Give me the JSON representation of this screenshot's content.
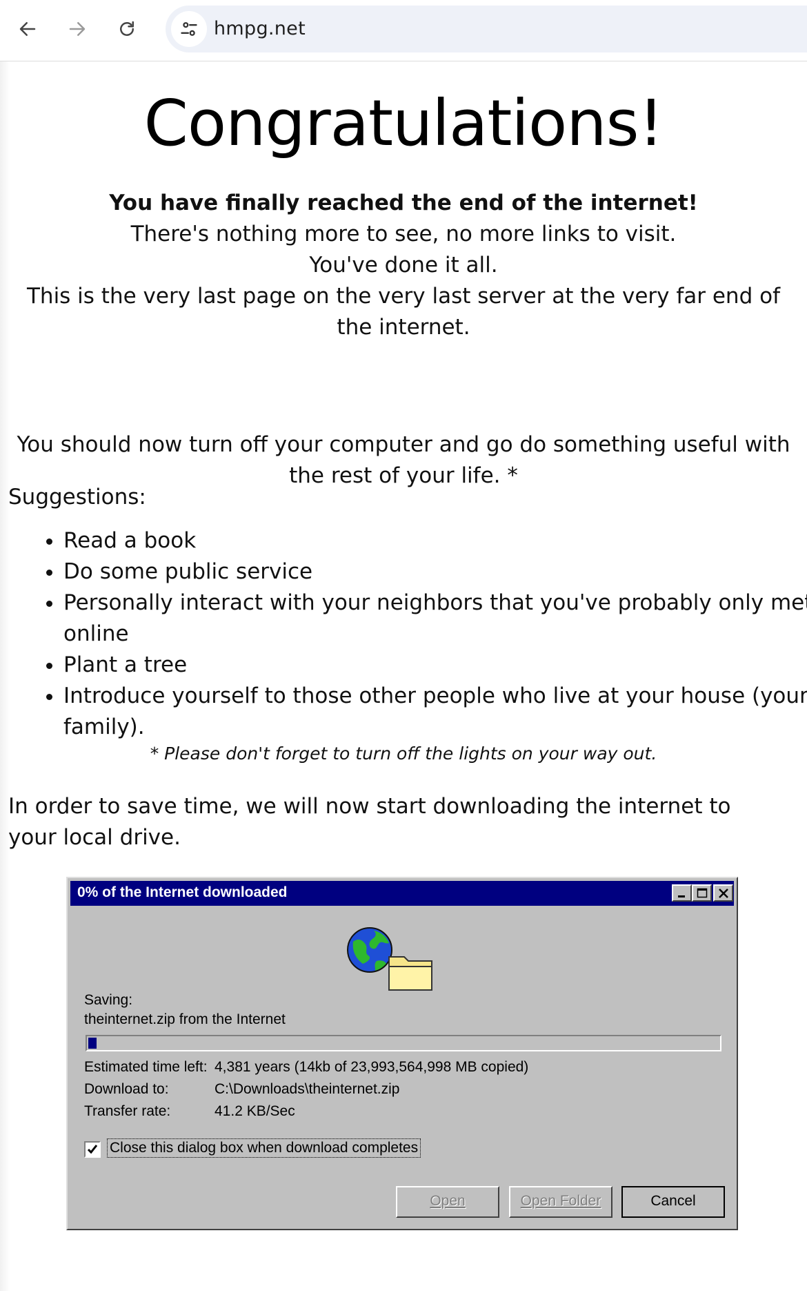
{
  "browser": {
    "url": "hmpg.net",
    "back_icon": "arrow-left-icon",
    "forward_icon": "arrow-right-icon",
    "reload_icon": "reload-icon",
    "site_info_icon": "tune-icon"
  },
  "page": {
    "title": "Congratulations!",
    "lead_bold": "You have finally reached the end of the internet!",
    "lines": [
      "There's nothing more to see, no more links to visit.",
      "You've done it all.",
      "This is the very last page on the very last server at the very far end of the internet."
    ],
    "advice": "You should now turn off your computer and go do something useful with the rest of your life. *",
    "suggestions_heading": "Suggestions:",
    "suggestions": [
      "Read a book",
      "Do some public service",
      "Personally interact with your neighbors that you've probably only met online",
      "Plant a tree",
      "Introduce yourself to those other people who live at your house (your family)."
    ],
    "note": "* Please don't forget to turn off the lights on your way out.",
    "download_intro": "In order to save time, we will now start downloading the internet to your local drive."
  },
  "dialog": {
    "title": "0% of the Internet downloaded",
    "saving_label": "Saving:",
    "saving_file": "theinternet.zip from the Internet",
    "progress_fraction": 0.012,
    "rows": [
      {
        "label": "Estimated time left:",
        "value": "4,381 years (14kb of 23,993,564,998 MB copied)"
      },
      {
        "label": "Download to:",
        "value": "C:\\Downloads\\theinternet.zip"
      },
      {
        "label": "Transfer rate:",
        "value": "41.2 KB/Sec"
      }
    ],
    "close_checkbox_label": "Close this dialog box when download completes",
    "close_checkbox_checked": true,
    "buttons": {
      "open": "Open",
      "open_folder": "Open Folder",
      "cancel": "Cancel"
    },
    "icons": {
      "globe": "globe-icon",
      "folder": "folder-icon"
    }
  }
}
